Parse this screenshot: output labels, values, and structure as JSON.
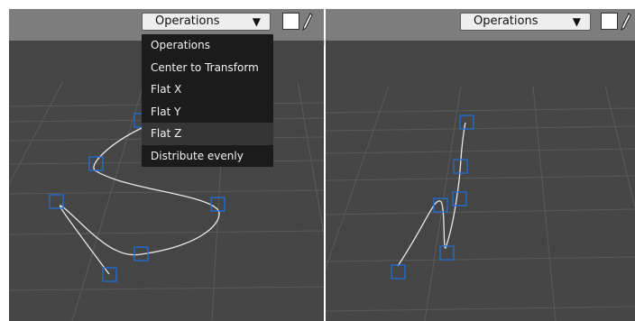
{
  "left_viewport": {
    "operations_button": {
      "label": "Operations",
      "caret": "▼"
    },
    "color_swatch": "#ffffff",
    "pen_icon": "pencil-icon",
    "dropdown_menu": {
      "items": [
        {
          "label": "Operations"
        },
        {
          "label": "Center to Transform"
        },
        {
          "label": "Flat X"
        },
        {
          "label": "Flat Y"
        },
        {
          "label": "Flat Z",
          "highlighted": true
        },
        {
          "label": "Distribute evenly"
        }
      ]
    },
    "curve_control_points": 7
  },
  "right_viewport": {
    "operations_button": {
      "label": "Operations",
      "caret": "▼"
    },
    "color_swatch": "#ffffff",
    "pen_icon": "pencil-icon",
    "curve_control_points": 6
  },
  "colors": {
    "toolbar": "#7d7d7d",
    "viewport_bg": "#454545",
    "grid": "#5a5a5a",
    "curve": "#e8e8e8",
    "control_point": "#1f6fd6",
    "menu_bg": "#1b1b1b",
    "menu_highlight": "#353535"
  }
}
